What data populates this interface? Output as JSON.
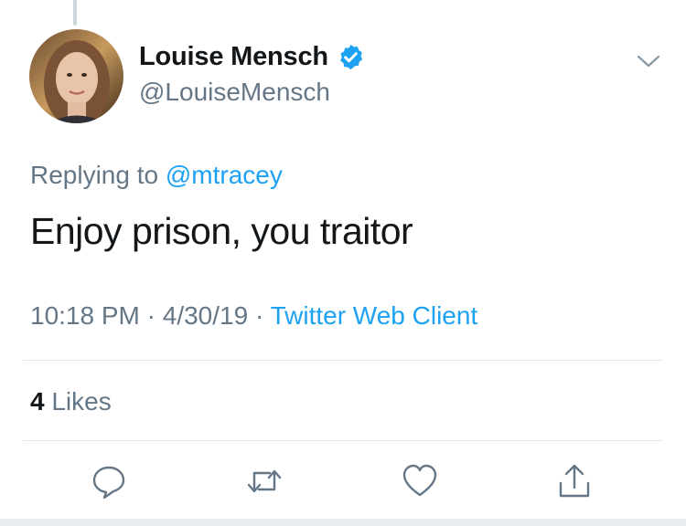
{
  "author": {
    "display_name": "Louise Mensch",
    "handle": "@LouiseMensch",
    "verified_icon": "verified-badge-icon"
  },
  "reply": {
    "prefix": "Replying to",
    "mention": "@mtracey"
  },
  "tweet": {
    "text": "Enjoy prison, you traitor",
    "time": "10:18 PM",
    "separator": "·",
    "date": "4/30/19",
    "source": "Twitter Web Client"
  },
  "stats": {
    "likes_count": "4",
    "likes_label": "Likes"
  },
  "actions": [
    {
      "name": "reply",
      "icon": "reply-icon"
    },
    {
      "name": "retweet",
      "icon": "retweet-icon"
    },
    {
      "name": "like",
      "icon": "heart-icon"
    },
    {
      "name": "share",
      "icon": "share-icon"
    }
  ],
  "colors": {
    "link": "#1da1f2",
    "secondary_text": "#657786",
    "primary_text": "#14171a",
    "divider": "#e1e8ed"
  }
}
